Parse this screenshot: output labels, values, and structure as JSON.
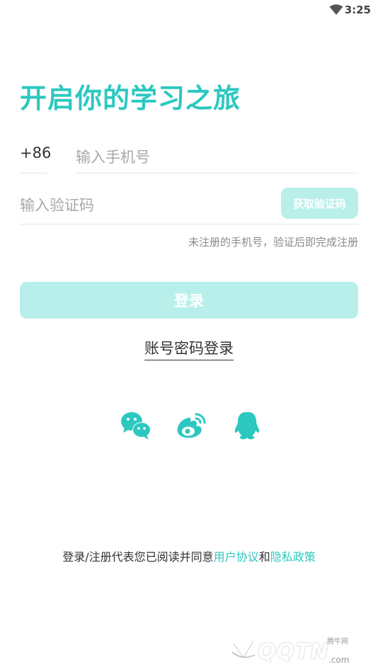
{
  "status_bar": {
    "time": "3:25",
    "icons": [
      "wifi-icon"
    ]
  },
  "header": {
    "title": "开启你的学习之旅"
  },
  "phone": {
    "country_code": "+86",
    "placeholder": "输入手机号",
    "value": ""
  },
  "verify": {
    "placeholder": "输入验证码",
    "value": "",
    "get_code_label": "获取验证码"
  },
  "hint": "未注册的手机号，验证后即完成注册",
  "login_label": "登录",
  "password_login_label": "账号密码登录",
  "social": [
    "wechat-icon",
    "weibo-icon",
    "qq-icon"
  ],
  "agreement": {
    "prefix": "登录/注册代表您已阅读并同意",
    "user_agreement": "用户协议",
    "and": "和",
    "privacy_policy": "隐私政策"
  },
  "watermark": {
    "brand": "QQTN",
    "small": "腾牛网",
    "domain": ".com"
  },
  "colors": {
    "accent": "#2cc8c0",
    "button_disabled": "#b8efeb"
  }
}
